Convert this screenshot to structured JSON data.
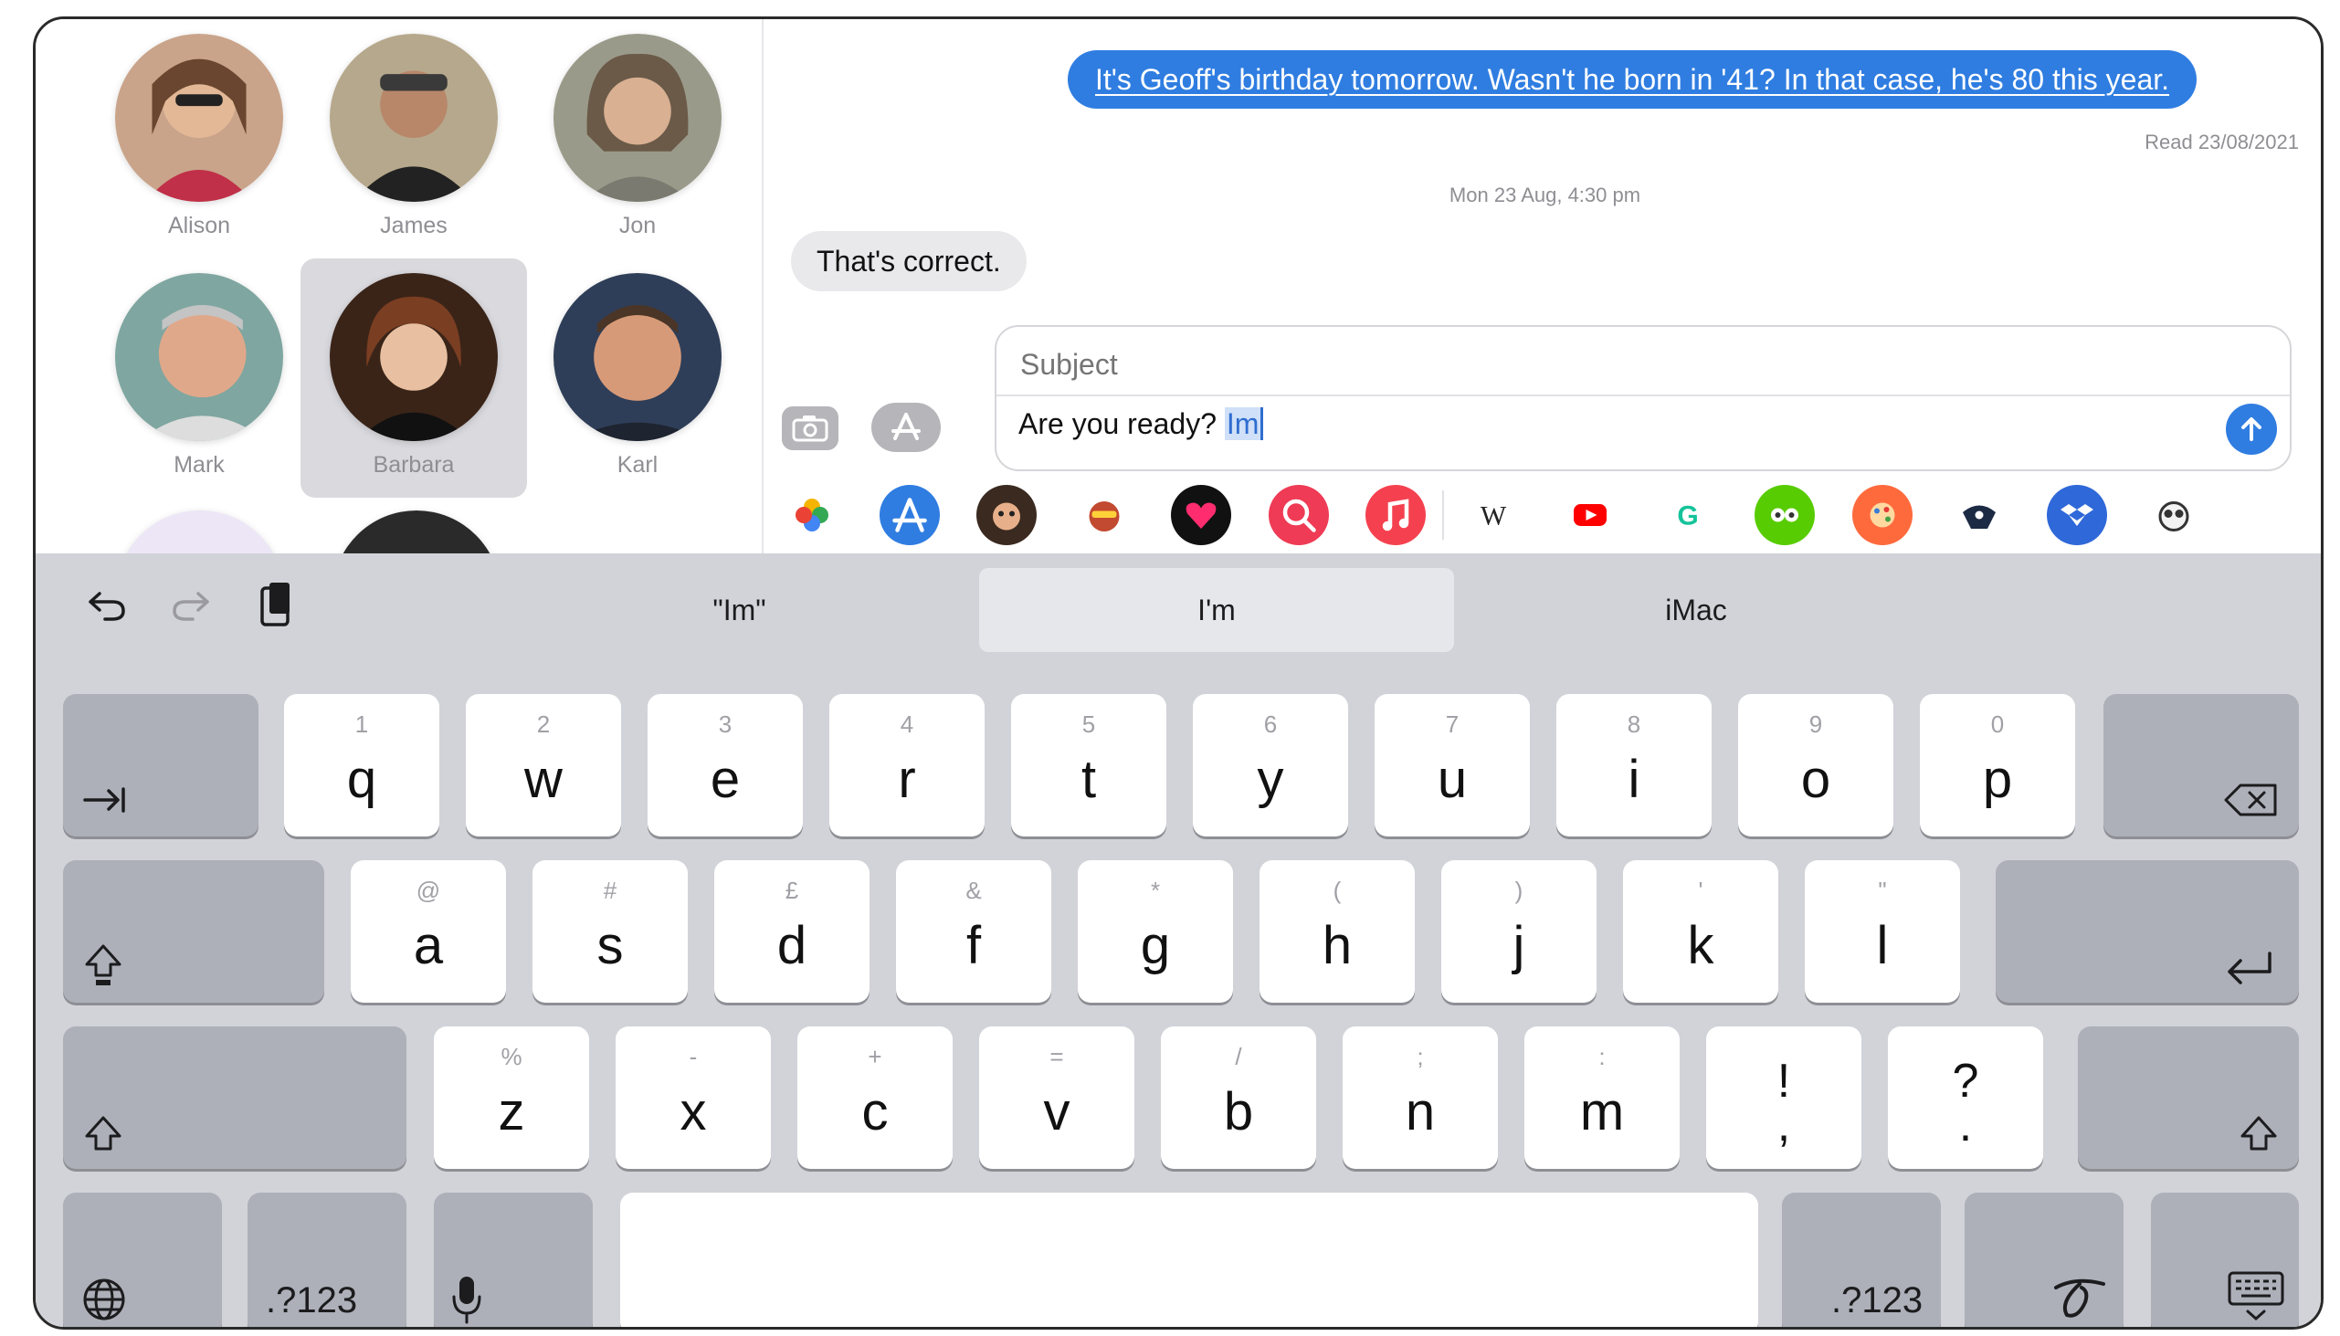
{
  "contacts": [
    {
      "name": "Alison"
    },
    {
      "name": "James"
    },
    {
      "name": "Jon"
    },
    {
      "name": "Mark"
    },
    {
      "name": "Barbara",
      "selected": true
    },
    {
      "name": "Karl"
    }
  ],
  "conversation": {
    "outgoing_message": "It's Geoff's birthday tomorrow. Wasn't he born in '41? In that case, he's 80 this year.",
    "read_receipt": "Read 23/08/2021",
    "timestamp": "Mon 23 Aug, 4:30 pm",
    "incoming_message": "That's correct.",
    "composer": {
      "subject_placeholder": "Subject",
      "text_before_selection": "Are you ready? ",
      "selected_text": "Im"
    }
  },
  "app_drawer": [
    "photos-app",
    "app-store-app",
    "memoji-app",
    "animoji-app",
    "digital-touch-app",
    "image-search-app",
    "music-app",
    "wikipedia-app",
    "youtube-app",
    "grammarly-app",
    "duolingo-app",
    "paint-app",
    "bird-app",
    "dropbox-app",
    "panda-app"
  ],
  "keyboard": {
    "suggestions": [
      "\"Im\"",
      "I'm",
      "iMac"
    ],
    "row1": [
      {
        "c": "q",
        "h": "1"
      },
      {
        "c": "w",
        "h": "2"
      },
      {
        "c": "e",
        "h": "3"
      },
      {
        "c": "r",
        "h": "4"
      },
      {
        "c": "t",
        "h": "5"
      },
      {
        "c": "y",
        "h": "6"
      },
      {
        "c": "u",
        "h": "7"
      },
      {
        "c": "i",
        "h": "8"
      },
      {
        "c": "o",
        "h": "9"
      },
      {
        "c": "p",
        "h": "0"
      }
    ],
    "row2": [
      {
        "c": "a",
        "h": "@"
      },
      {
        "c": "s",
        "h": "#"
      },
      {
        "c": "d",
        "h": "£"
      },
      {
        "c": "f",
        "h": "&"
      },
      {
        "c": "g",
        "h": "*"
      },
      {
        "c": "h",
        "h": "("
      },
      {
        "c": "j",
        "h": ")"
      },
      {
        "c": "k",
        "h": "'"
      },
      {
        "c": "l",
        "h": "\""
      }
    ],
    "row3": [
      {
        "c": "z",
        "h": "%"
      },
      {
        "c": "x",
        "h": "-"
      },
      {
        "c": "c",
        "h": "+"
      },
      {
        "c": "v",
        "h": "="
      },
      {
        "c": "b",
        "h": "/"
      },
      {
        "c": "n",
        "h": ";"
      },
      {
        "c": "m",
        "h": ":"
      }
    ],
    "punct": [
      {
        "top": "!",
        "bot": ","
      },
      {
        "top": "?",
        "bot": "."
      }
    ],
    "numbers_label": ".?123"
  },
  "colors": {
    "accent": "#2f7de1",
    "keyboard_bg": "#d2d3d8"
  }
}
